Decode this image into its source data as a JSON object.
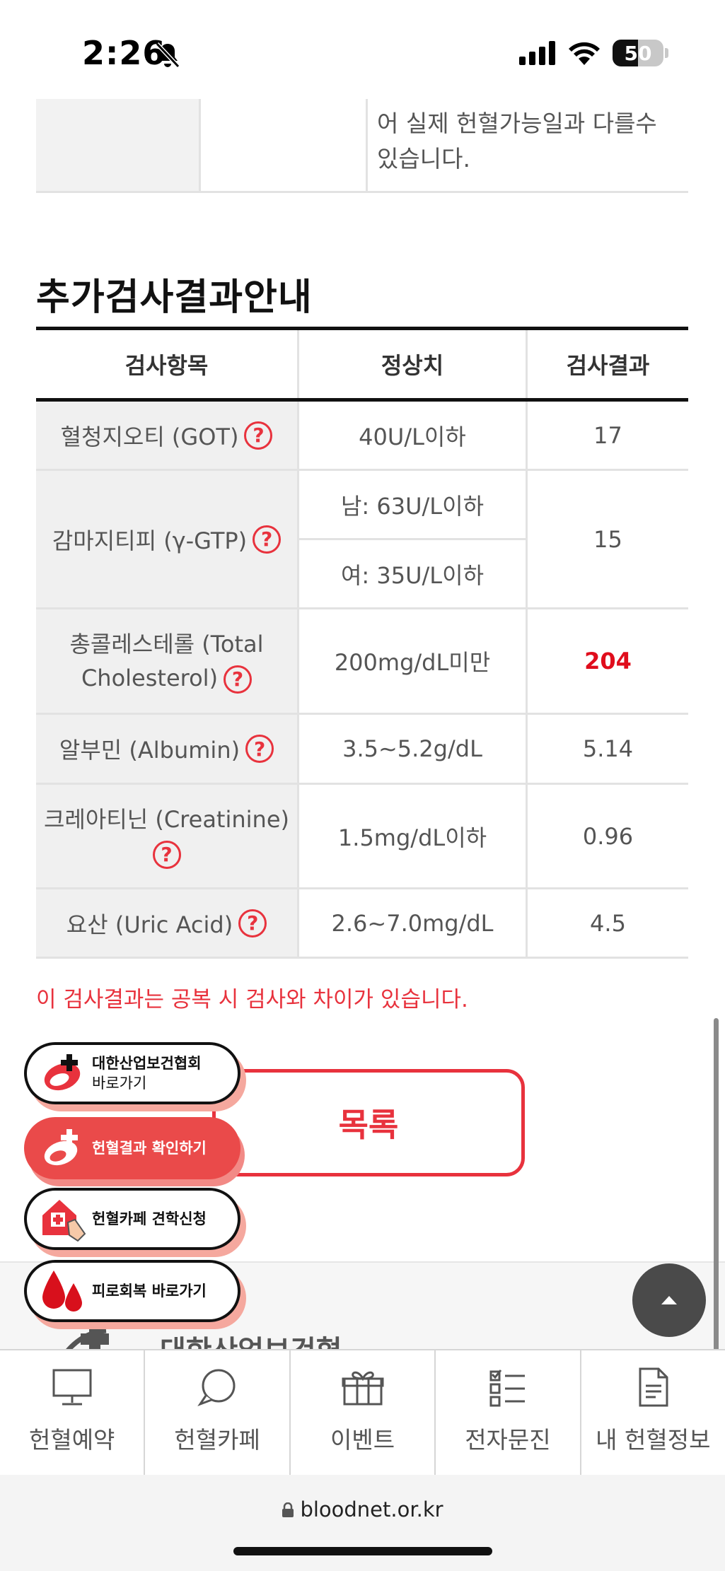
{
  "status_bar": {
    "time": "2:26",
    "battery": "50"
  },
  "top_table": {
    "text": "어 실제 헌혈가능일과 다를수 있습니다."
  },
  "section_title": "추가검사결과안내",
  "table": {
    "headers": [
      "검사항목",
      "정상치",
      "검사결과"
    ],
    "rows": [
      {
        "item": "혈청지오티 (GOT)",
        "normal": "40U/L이하",
        "result": "17"
      },
      {
        "item": "감마지티피 (γ-GTP)",
        "normal_male": "남: 63U/L이하",
        "normal_female": "여: 35U/L이하",
        "result": "15"
      },
      {
        "item": "총콜레스테롤 (Total Cholesterol)",
        "normal": "200mg/dL미만",
        "result": "204"
      },
      {
        "item": "알부민 (Albumin)",
        "normal": "3.5~5.2g/dL",
        "result": "5.14"
      },
      {
        "item": "크레아티닌 (Creatinine)",
        "normal": "1.5mg/dL이하",
        "result": "0.96"
      },
      {
        "item": "요산 (Uric Acid)",
        "normal": "2.6~7.0mg/dL",
        "result": "4.5"
      }
    ],
    "help_icon": "?"
  },
  "notice": "이 검사결과는 공복 시 검사와 차이가 있습니다.",
  "list_button": "목록",
  "floating_menu": [
    {
      "line1": "대한산업보건협회",
      "line2": "바로가기",
      "icon": "kiha-logo-icon"
    },
    {
      "line1": "헌혈결과 확인하기",
      "icon": "blood-result-icon"
    },
    {
      "line1": "헌혈카페 견학신청",
      "icon": "cafe-tour-icon"
    },
    {
      "line1": "피로회복 바로가기",
      "icon": "blood-drop-icon"
    }
  ],
  "footer_logo_text": "대한산업보건협회",
  "bottom_nav": [
    {
      "label": "헌혈예약",
      "icon": "monitor-icon"
    },
    {
      "label": "헌혈카페",
      "icon": "chat-icon"
    },
    {
      "label": "이벤트",
      "icon": "gift-box-icon"
    },
    {
      "label": "전자문진",
      "icon": "checklist-icon"
    },
    {
      "label": "내 헌혈정보",
      "icon": "document-icon"
    }
  ],
  "url": "bloodnet.or.kr",
  "colors": {
    "accent_red": "#e8323d",
    "highlight_value": "#e00d1c"
  }
}
